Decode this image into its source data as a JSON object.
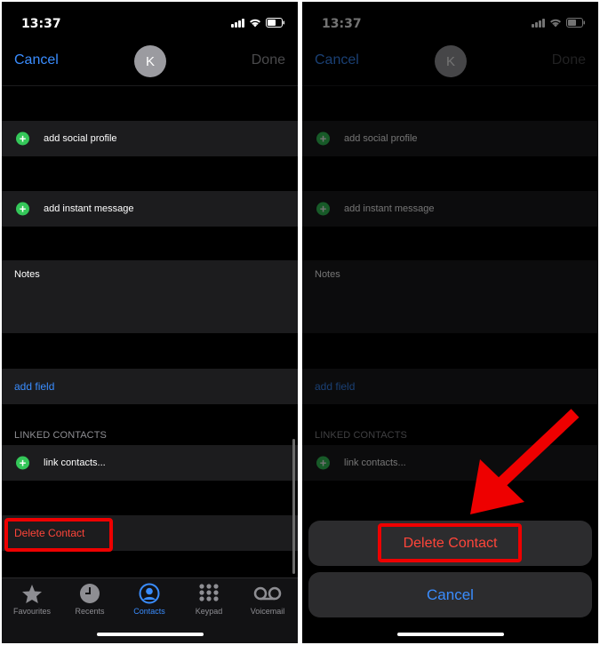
{
  "status": {
    "time": "13:37"
  },
  "nav": {
    "cancel": "Cancel",
    "done": "Done",
    "avatar_initial": "K"
  },
  "rows": {
    "social": "add social profile",
    "instant": "add instant message",
    "notes": "Notes",
    "add_field": "add field",
    "linked_header": "LINKED CONTACTS",
    "link": "link contacts...",
    "delete": "Delete Contact"
  },
  "tabs": [
    {
      "label": "Favourites",
      "icon": "star-icon"
    },
    {
      "label": "Recents",
      "icon": "clock-icon"
    },
    {
      "label": "Contacts",
      "icon": "person-circle-icon",
      "active": true
    },
    {
      "label": "Keypad",
      "icon": "keypad-icon"
    },
    {
      "label": "Voicemail",
      "icon": "voicemail-icon"
    }
  ],
  "action_sheet": {
    "delete": "Delete Contact",
    "cancel": "Cancel"
  },
  "colors": {
    "accent": "#3a8dff",
    "destructive": "#ff453a",
    "add": "#34c759",
    "highlight": "#ee0000"
  }
}
